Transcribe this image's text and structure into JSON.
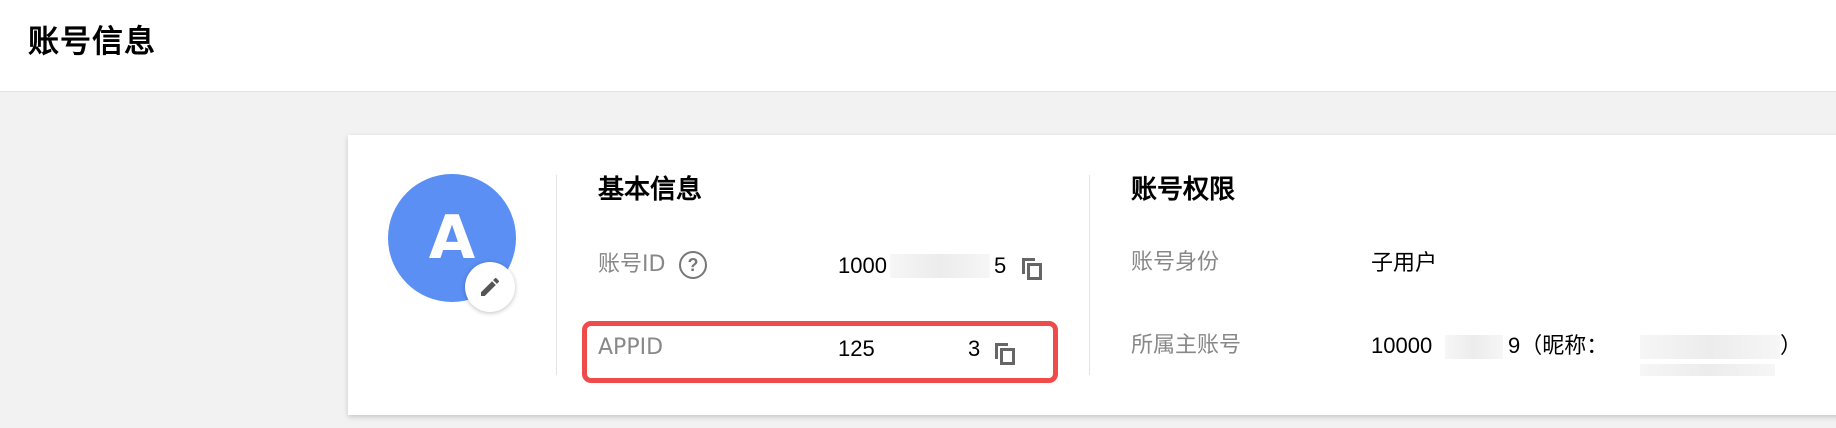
{
  "page": {
    "title": "账号信息"
  },
  "avatar": {
    "letter": "A",
    "color": "#5b8ff4",
    "edit_icon": "pencil-icon"
  },
  "basic_info": {
    "title": "基本信息",
    "account_id": {
      "label": "账号ID",
      "value_prefix": "1000",
      "value_suffix": "5"
    },
    "appid": {
      "label": "APPID",
      "value_prefix": "125",
      "value_suffix": "3"
    }
  },
  "permissions": {
    "title": "账号权限",
    "identity": {
      "label": "账号身份",
      "value": "子用户"
    },
    "owner": {
      "label": "所属主账号",
      "value_prefix": "10000",
      "value_suffix": "9（昵称：",
      "close_paren": "）"
    }
  },
  "highlight_color": "#ef4b4b"
}
